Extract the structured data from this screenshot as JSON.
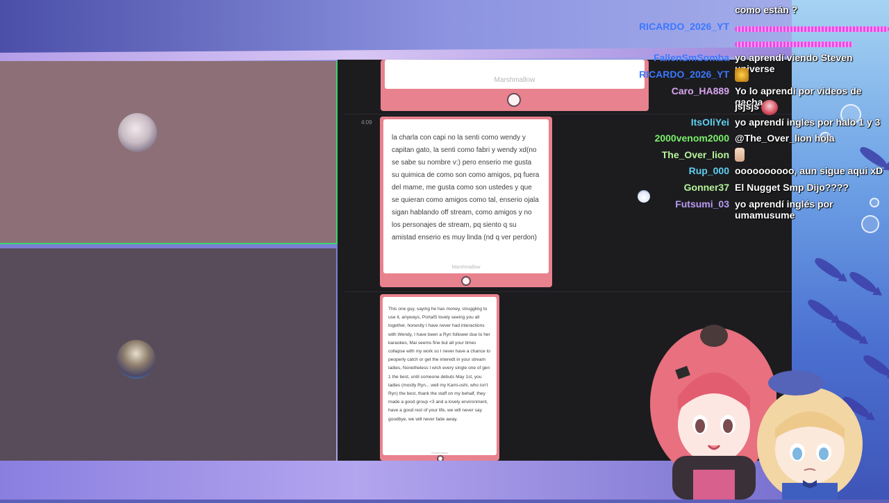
{
  "browser": {
    "timestamp": "4:09",
    "cards": [
      {
        "signature": "Marshmallow"
      },
      {
        "signature": "Marshmallow",
        "text": "la charla con capi no la senti como wendy y capitan gato, la senti como fabri y wendy xd(no se sabe su nombre v:) pero enserio me gusta su quimica de como son como amigos, pq fuera del mame, me gusta como son ustedes y que se quieran como amigos como tal, enserio ojala sigan hablando off stream, como amigos y no los personajes de stream, pq siento q su amistad enserio es muy linda (nd q ver perdon)"
      },
      {
        "signature": "Marshmallow",
        "text": "This one guy, saying he has money, struggling to use it, anyways, PortalS lovely seeing you all together, honestly I have never had interactions with Wendy, I have been a Ryn follower due to her karaokes, Mai seems fine but all your times collapse with my work so I never have a chance to peoperly catch or get the interedt in your stream ladies, Nonetheless I wish every single one of gen 1 the best, until someone debuts May 1st, you ladies (mostly Ryn... well my Kami-oshi, who isn't Ryn) the best, thank the staff on my behalf, they made a good group <3 and a lovely environment, have a good rest of your life, we will never say goodbye, we will never fade away."
      }
    ]
  },
  "chat": [
    {
      "name": "",
      "message": "como están ?",
      "color": "#ffffff"
    },
    {
      "name": "RICARDO_2026_YT",
      "message": "",
      "color": "#3b78ff",
      "emote": "pink-sparkle-emote"
    },
    {
      "name": "FallenSmSomba",
      "message": "yo aprendí viendo Steven universe",
      "color": "#3b78ff"
    },
    {
      "name": "RICARDO_2026_YT",
      "message": "",
      "color": "#3b78ff",
      "emote": "gold-emote"
    },
    {
      "name": "Caro_HA889",
      "message": "Yo lo aprendí por videos de gacha",
      "color": "#d9a7f0"
    },
    {
      "name": "",
      "message": "jsjsjs",
      "color": "#ffffff",
      "emote": "character-emote"
    },
    {
      "name": "ItsOliYei",
      "message": "yo aprendí ingles por halo 1 y 3",
      "color": "#5fd0f0"
    },
    {
      "name": "2000venom2000",
      "message": "@The_Over_lion hola",
      "color": "#7af06a"
    },
    {
      "name": "The_Over_lion",
      "message": "",
      "color": "#b7f59a",
      "emote": "hand-emote"
    },
    {
      "name": "Rup_000",
      "message": "oooooooooo, aun sigue aqui xD",
      "color": "#5fd0f0"
    },
    {
      "name": "Gonner37",
      "message": "El Nugget Smp Dijo????",
      "color": "#b7f59a"
    },
    {
      "name": "Futsumi_03",
      "message": "yo aprendí inglés por umamusume",
      "color": "#b99af5"
    }
  ],
  "colors": {
    "card_pink": "#e8828e",
    "cam_border": "#3bd36b",
    "browser_bg": "#1c1c1f"
  }
}
